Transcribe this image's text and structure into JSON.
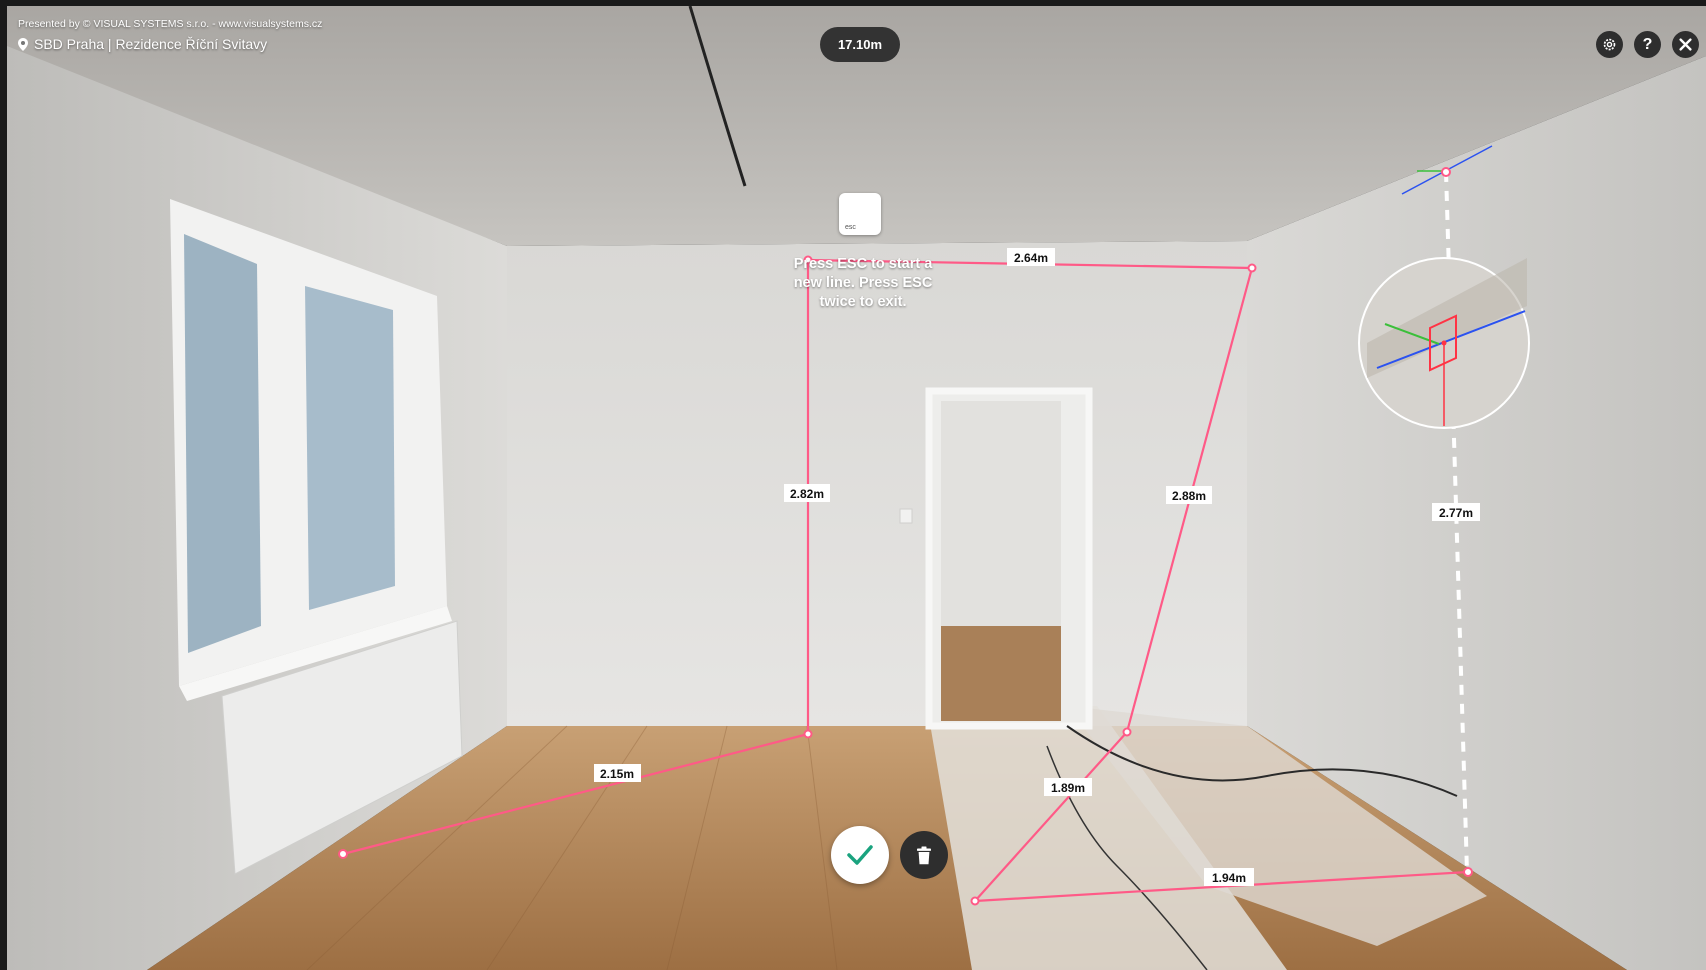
{
  "header": {
    "presented_by": "Presented by © VISUAL SYSTEMS s.r.o. - www.visualsystems.cz",
    "location": "SBD Praha | Rezidence Říční Svitavy"
  },
  "measurement": {
    "total": "17.10m",
    "segments": [
      "2.64m",
      "2.82m",
      "2.88m",
      "2.15m",
      "1.89m",
      "1.94m",
      "2.77m"
    ]
  },
  "hint": {
    "key_label": "esc",
    "text": "Press ESC to start a new line. Press ESC twice to exit."
  },
  "toolbar": {
    "settings_icon": "gear-icon",
    "help_label": "?",
    "close_icon": "close-icon"
  },
  "actions": {
    "confirm_icon": "check-icon",
    "delete_icon": "trash-icon"
  },
  "colors": {
    "measure_line": "#ff5a87",
    "confirm_check": "#1aa37f",
    "dark_button": "#2e2e2e"
  }
}
